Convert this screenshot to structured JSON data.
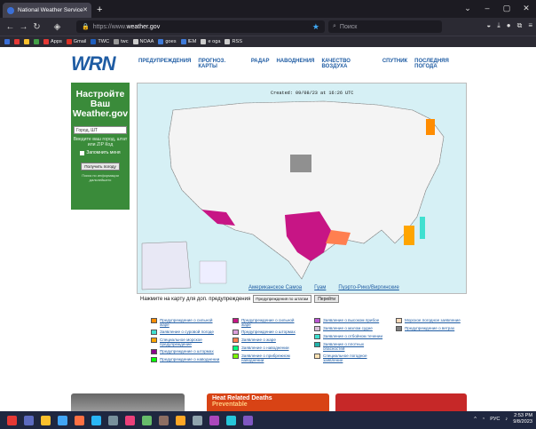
{
  "browser": {
    "tab_title": "National Weather Service",
    "url_prefix": "https://www.",
    "url_domain": "weather.gov",
    "search_placeholder": "Поиск",
    "bookmarks": [
      "Apps",
      "Gmail",
      "TWC",
      "twc",
      "NOAA",
      "goes",
      "IEM",
      "e oga",
      "RSS"
    ]
  },
  "site": {
    "logo_text": "WRN",
    "nav": [
      "ПРЕДУПРЕЖДЕНИЯ",
      "ПРОГНОЗ. КАРТЫ",
      "РАДАР",
      "НАВОДНЕНИЯ",
      "КАЧЕСТВО ВОЗДУХА",
      "СПУТНИК",
      "ПОСЛЕДНЯЯ ПОГОДА"
    ],
    "sidebar": {
      "heading": "Настройте Ваш Weather.gov",
      "input_value": "Город, ШТ",
      "note": "Введите ваш город, штат или ZIP Код",
      "remember_label": "Запомнить меня",
      "button_label": "Получить погоду",
      "small_note": "Поиск по информации дальнейшего"
    },
    "map": {
      "created": "Created: 09/08/23 at 16:26 UTC",
      "links": [
        "Американское Самоа",
        "Гуам",
        "Пуэрто-Рико/Виргинские"
      ],
      "select_prompt": "Нажмите на карту для доп. предупреждения",
      "select_value": "Предупреждения по штатам",
      "go_label": "Перейти"
    },
    "legend": [
      {
        "label": "Предупреждение о сильной жаре",
        "color": "#ff8c00"
      },
      {
        "label": "Заявление о суровой погоде",
        "color": "#40e0d0"
      },
      {
        "label": "Специальное морское предупреждение",
        "color": "#ffa500"
      },
      {
        "label": "Предупреждение о штормах",
        "color": "#8b008b"
      },
      {
        "label": "Предупреждение о наводнении",
        "color": "#00ff00"
      },
      {
        "label": "Предупреждение о сильной жаре",
        "color": "#c71585"
      },
      {
        "label": "Предупреждение о штормах",
        "color": "#dda0dd"
      },
      {
        "label": "Заявление о жаре",
        "color": "#ff7f50"
      },
      {
        "label": "Заявление о наводнении",
        "color": "#00ff7f"
      },
      {
        "label": "Заявление о прибрежном наводнении",
        "color": "#7cfc00"
      },
      {
        "label": "Заявление о высоком прибое",
        "color": "#ba55d3"
      },
      {
        "label": "Заявление о малом судне",
        "color": "#d8bfd8"
      },
      {
        "label": "Заявление о отбойном течении",
        "color": "#40e0d0"
      },
      {
        "label": "Заявление о плотных опасностей",
        "color": "#20b2aa"
      },
      {
        "label": "Специальное погодное заявление",
        "color": "#ffe4b5"
      },
      {
        "label": "Морское погодное заявление",
        "color": "#ffdab9"
      },
      {
        "label": "Предупреждение о ветрах",
        "color": "#808080"
      }
    ],
    "cards": [
      "Heat Related Deaths",
      "Preventable"
    ]
  },
  "taskbar": {
    "lang": "РУС",
    "time": "2:53 PM",
    "date": "9/8/2023"
  }
}
